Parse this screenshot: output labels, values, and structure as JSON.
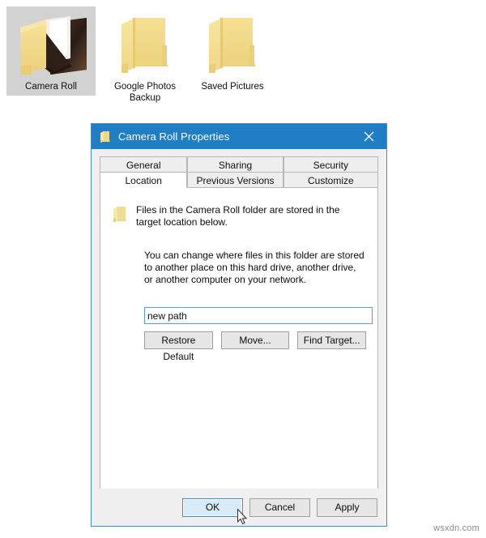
{
  "desktop": {
    "icons": [
      {
        "label": "Camera Roll",
        "icon": "folder-open-photo-icon",
        "selected": true
      },
      {
        "label": "Google Photos Backup",
        "icon": "folder-icon",
        "selected": false
      },
      {
        "label": "Saved Pictures",
        "icon": "folder-icon",
        "selected": false
      }
    ]
  },
  "dialog": {
    "title": "Camera Roll Properties",
    "title_icon": "folder-icon",
    "close_icon": "close-icon",
    "tabs_row_top": [
      {
        "label": "General",
        "active": false
      },
      {
        "label": "Sharing",
        "active": false
      },
      {
        "label": "Security",
        "active": false
      }
    ],
    "tabs_row_bottom": [
      {
        "label": "Location",
        "active": true
      },
      {
        "label": "Previous Versions",
        "active": false
      },
      {
        "label": "Customize",
        "active": false
      }
    ],
    "content": {
      "info_icon": "folder-icon",
      "paragraph1": "Files in the Camera Roll folder are stored in the target location below.",
      "paragraph2": "You can change where files in this folder are stored to another place on this hard drive, another drive, or another computer on your network.",
      "path_value": "new path",
      "path_placeholder": "",
      "buttons": [
        {
          "label": "Restore Default"
        },
        {
          "label": "Move..."
        },
        {
          "label": "Find Target..."
        }
      ]
    },
    "footer_buttons": [
      {
        "label": "OK",
        "state": "hover"
      },
      {
        "label": "Cancel",
        "state": "normal"
      },
      {
        "label": "Apply",
        "state": "normal"
      }
    ]
  },
  "watermark": "wsxdn.com",
  "colors": {
    "title_bar": "#1f7ec4",
    "dialog_border": "#3b8ed0",
    "folder_yellow": "#f5dd8b",
    "selection_gray": "#d2d2d2",
    "ok_highlight": "#d8ecf8"
  }
}
